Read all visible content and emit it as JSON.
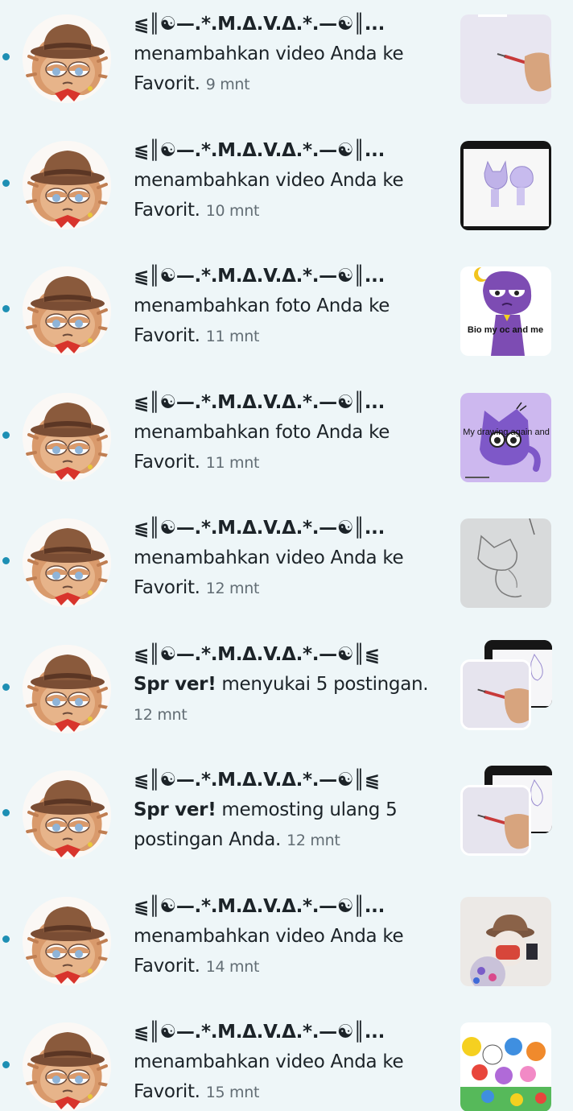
{
  "notifications": [
    {
      "user": "⫹║☯—.*.M.Δ.V.Δ.*.—☯║...",
      "action": "menambahkan video Anda ke Favorit.",
      "time": "9 mnt",
      "thumb": "drawing-hand-video"
    },
    {
      "user": "⫹║☯—.*.M.Δ.V.Δ.*.—☯║...",
      "action": "menambahkan video Anda ke Favorit.",
      "time": "10 mnt",
      "thumb": "purple-cat-sketch"
    },
    {
      "user": "⫹║☯—.*.M.Δ.V.Δ.*.—☯║...",
      "action": "menambahkan foto Anda ke Favorit.",
      "time": "11 mnt",
      "thumb": "purple-character-bio",
      "thumb_caption": "Bio my oc and me"
    },
    {
      "user": "⫹║☯—.*.M.Δ.V.Δ.*.—☯║...",
      "action": "menambahkan foto Anda ke Favorit.",
      "time": "11 mnt",
      "thumb": "purple-cat-drawing",
      "thumb_caption": "My drawing again and"
    },
    {
      "user": "⫹║☯—.*.M.Δ.V.Δ.*.—☯║...",
      "action": "menambahkan video Anda ke Favorit.",
      "time": "12 mnt",
      "thumb": "pencil-sketch"
    },
    {
      "user": "⫹║☯—.*.M.Δ.V.Δ.*.—☯║⫹",
      "actor": "Spr ver!",
      "action": "menyukai 5 postingan.",
      "time": "12 mnt",
      "thumb": "stacked-posts"
    },
    {
      "user": "⫹║☯—.*.M.Δ.V.Δ.*.—☯║⫹",
      "actor": "Spr ver!",
      "action": "memosting ulang 5 postingan Anda.",
      "time": "12 mnt",
      "thumb": "stacked-posts"
    },
    {
      "user": "⫹║☯—.*.M.Δ.V.Δ.*.—☯║...",
      "action": "menambahkan video Anda ke Favorit.",
      "time": "14 mnt",
      "thumb": "hat-character-photo"
    },
    {
      "user": "⫹║☯—.*.M.Δ.V.Δ.*.—☯║...",
      "action": "menambahkan video Anda ke Favorit.",
      "time": "15 mnt",
      "thumb": "colorful-group-drawing"
    }
  ],
  "colors": {
    "background": "#eef6f8",
    "unread_dot": "#1d8fb4",
    "text": "#1c2328",
    "time": "#626d74"
  }
}
